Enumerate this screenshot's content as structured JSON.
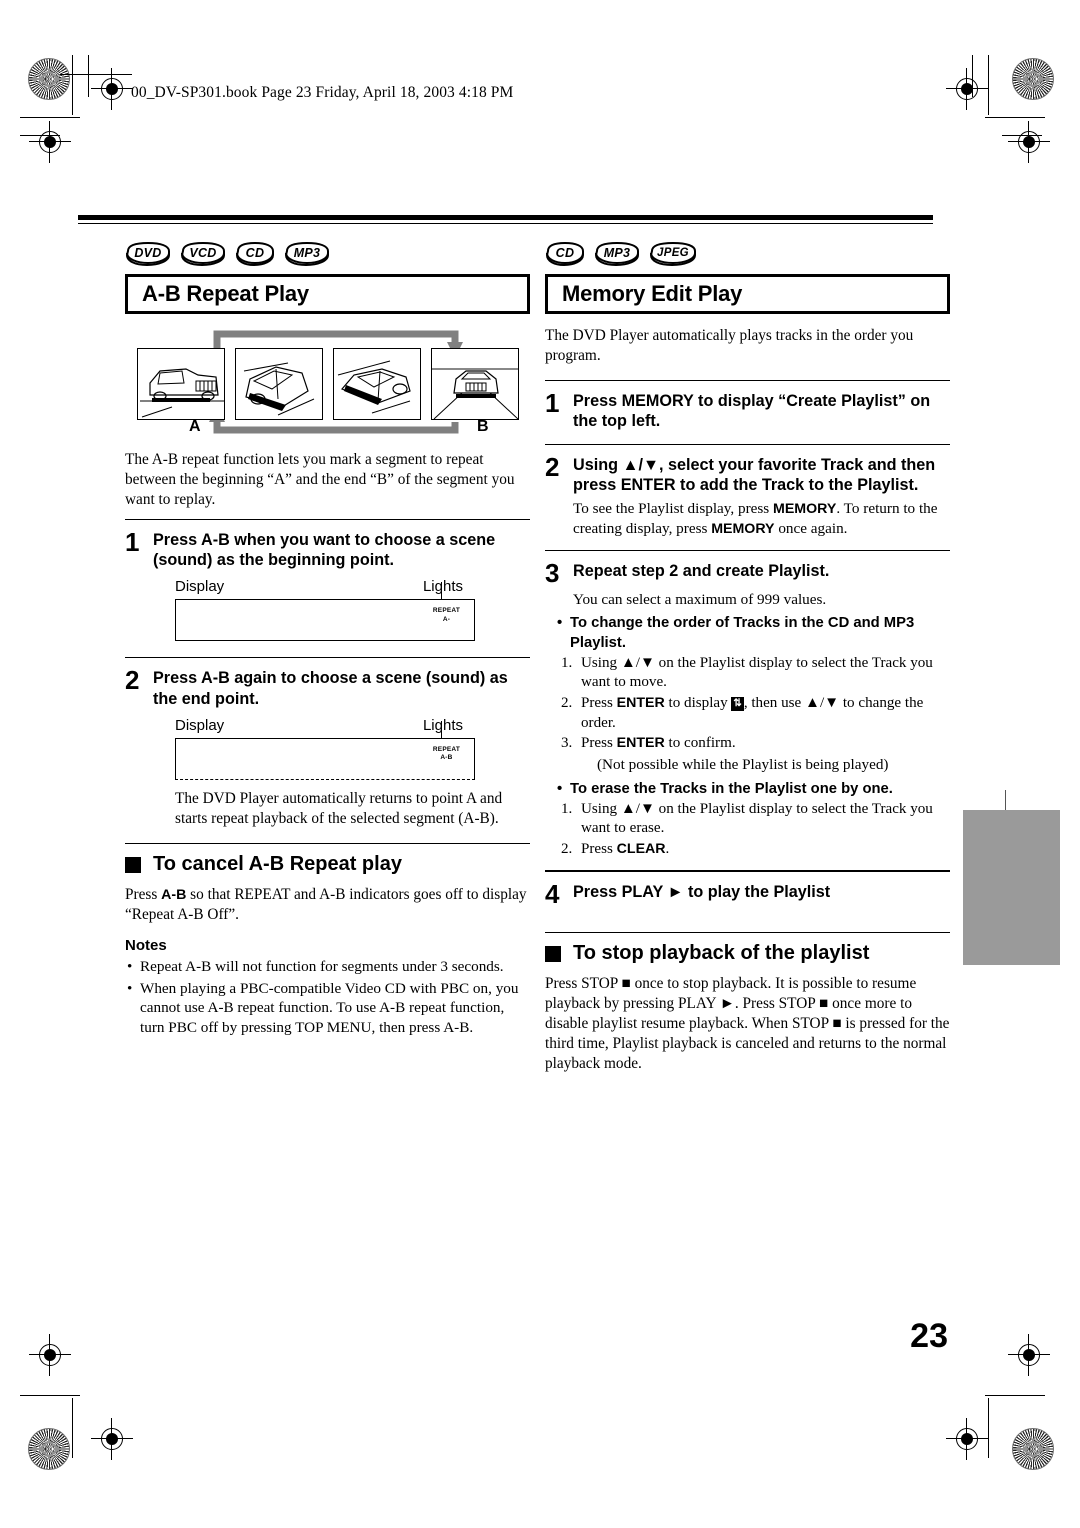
{
  "header": {
    "file_line": "00_DV-SP301.book  Page 23  Friday, April 18, 2003  4:18 PM"
  },
  "page_number": "23",
  "colors": {
    "ink": "#000000",
    "side_tab": "#9a9a9a",
    "arrow_gray": "#808080"
  },
  "left_column": {
    "badges": [
      "DVD",
      "VCD",
      "CD",
      "MP3"
    ],
    "title": "A-B Repeat Play",
    "illustration": {
      "label_a": "A",
      "label_b": "B",
      "frames": [
        "car-front-quarter",
        "car-side-rear",
        "car-side-front",
        "car-front"
      ]
    },
    "intro": "The A-B repeat function lets you mark a segment to repeat between the beginning “A” and the end “B” of the segment you want to replay.",
    "steps": [
      {
        "num": "1",
        "text": "Press A-B when you want to choose a scene (sound) as the beginning point.",
        "display_label": "Display",
        "lights_label": "Lights",
        "lcd_line1": "REPEAT",
        "lcd_line2": "A-"
      },
      {
        "num": "2",
        "text": "Press A-B again to choose a scene (sound) as the end point.",
        "display_label": "Display",
        "lights_label": "Lights",
        "lcd_line1": "REPEAT",
        "lcd_line2": "A-B",
        "after": "The DVD Player automatically returns to point A and starts repeat playback of the selected segment (A-B)."
      }
    ],
    "cancel_heading": "To cancel A-B Repeat play",
    "cancel_body_1": "Press ",
    "cancel_body_key": "A-B",
    "cancel_body_2": " so that REPEAT and A-B indicators goes off to display “Repeat A-B Off”.",
    "notes_heading": "Notes",
    "notes": [
      "Repeat A-B will not function for segments under 3 seconds.",
      "When playing a PBC-compatible Video CD with PBC on, you cannot use A-B repeat function. To use A-B repeat function, turn PBC off by pressing TOP MENU, then press A-B."
    ]
  },
  "right_column": {
    "badges": [
      "CD",
      "MP3",
      "JPEG"
    ],
    "title": "Memory Edit Play",
    "intro": "The DVD Player automatically plays tracks in the order you program.",
    "step1": {
      "num": "1",
      "text": "Press MEMORY to display “Create Playlist” on the top left."
    },
    "step2": {
      "num": "2",
      "text": "Using ▲/▼, select your favorite Track and then press ENTER to add the Track to the Playlist.",
      "note_a": "To see the Playlist display, press ",
      "note_key1": "MEMORY",
      "note_b": ". To return to the creating display, press ",
      "note_key2": "MEMORY",
      "note_c": " once again."
    },
    "step3": {
      "num": "3",
      "text": "Repeat step 2 and create Playlist.",
      "note": "You can select a maximum of 999 values.",
      "bullet1": "To change the order of Tracks in the CD and MP3 Playlist.",
      "bullet1_items": [
        {
          "n": "1.",
          "pre": "Using ▲/▼ on the Playlist display to select the Track you want to move.",
          "post": ""
        },
        {
          "n": "2.",
          "pre": "Press ",
          "key": "ENTER",
          "mid": " to display ",
          "icon": "order-swap-icon",
          "post": ", then use ▲/▼ to change the order."
        },
        {
          "n": "3.",
          "pre": "Press ",
          "key": "ENTER",
          "post": " to confirm."
        }
      ],
      "bullet1_paren": "(Not possible while the Playlist is being played)",
      "bullet2": "To erase the Tracks in the Playlist one by one.",
      "bullet2_items": [
        {
          "n": "1.",
          "pre": "Using ▲/▼ on the Playlist display to select the Track you want to erase."
        },
        {
          "n": "2.",
          "pre": "Press ",
          "key": "CLEAR",
          "post": "."
        }
      ]
    },
    "step4": {
      "num": "4",
      "text": "Press PLAY ► to play the Playlist"
    },
    "stop_heading": "To stop playback of the playlist",
    "stop_body": "Press STOP ■ once to stop playback. It is possible to resume playback by pressing PLAY ►. Press STOP ■ once more to disable playlist resume playback. When STOP ■ is pressed for the third time, Playlist playback is canceled and returns to the normal playback mode."
  }
}
